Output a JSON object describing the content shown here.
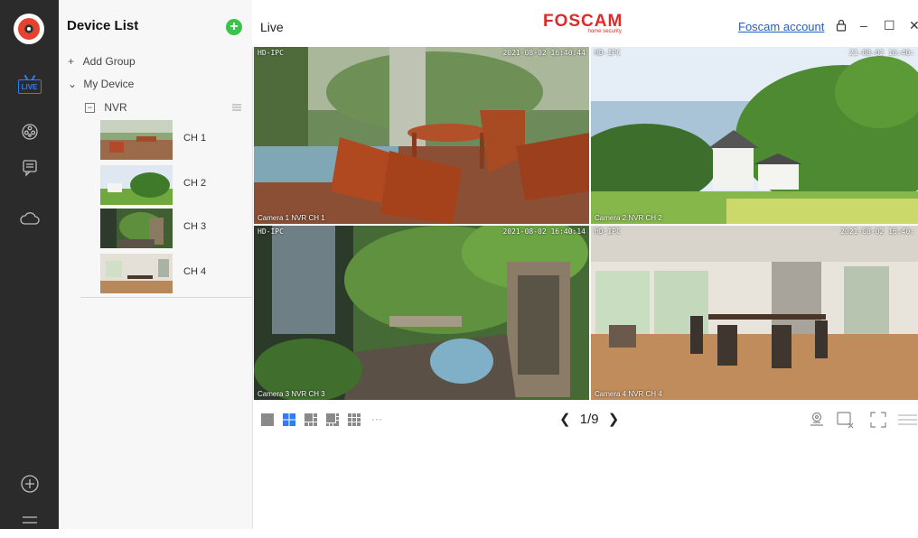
{
  "app": {
    "brand_name": "FOSCAM",
    "brand_tagline": "home security",
    "page_title": "Live",
    "account_link": "Foscam account",
    "colors": {
      "accent": "#2f7cf6",
      "brand": "#e02a2a",
      "add": "#3cc34a",
      "rail": "#2b2b2b"
    }
  },
  "window_controls": {
    "lock": "lock-icon",
    "minimize": "–",
    "maximize": "☐",
    "close": "✕"
  },
  "sidebar_rail": {
    "items": [
      {
        "name": "live",
        "label": "LIVE",
        "icon": "live-tv-icon",
        "active": true
      },
      {
        "name": "playback",
        "icon": "film-reel-icon"
      },
      {
        "name": "messages",
        "icon": "message-icon"
      },
      {
        "name": "cloud",
        "icon": "cloud-icon"
      },
      {
        "name": "add",
        "icon": "plus-circle-icon"
      },
      {
        "name": "menu",
        "icon": "menu-icon"
      }
    ]
  },
  "device_list": {
    "title": "Device List",
    "add_group": "Add Group",
    "my_device": "My Device",
    "nvr_label": "NVR",
    "channels": [
      {
        "label": "CH 1"
      },
      {
        "label": "CH 2"
      },
      {
        "label": "CH 3"
      },
      {
        "label": "CH 4"
      }
    ]
  },
  "video_tiles": [
    {
      "tag": "HD-IPC",
      "timestamp": "2021-08-02 16:40:44",
      "caption": "Camera 1 NVR CH 1"
    },
    {
      "tag": "HD-IPC",
      "timestamp": "21-08-02 16:40:",
      "caption": "Camera 2 NVR CH 2"
    },
    {
      "tag": "HD-IPC",
      "timestamp": "2021-08-02 16:40:14",
      "caption": "Camera 3 NVR CH 3"
    },
    {
      "tag": "HD-IPC",
      "timestamp": "2021-08-02 16:40:",
      "caption": "Camera 4 NVR CH 4"
    }
  ],
  "toolbar": {
    "page_prev": "❮",
    "page_indicator": "1/9",
    "page_next": "❯",
    "more_layouts": "···",
    "layouts": [
      "single-layout-icon",
      "quad-layout-icon",
      "six-layout-icon",
      "eight-layout-icon",
      "nine-layout-icon"
    ],
    "tools": [
      "ptz-icon",
      "close-all-icon",
      "fullscreen-icon",
      "menu-icon"
    ]
  }
}
